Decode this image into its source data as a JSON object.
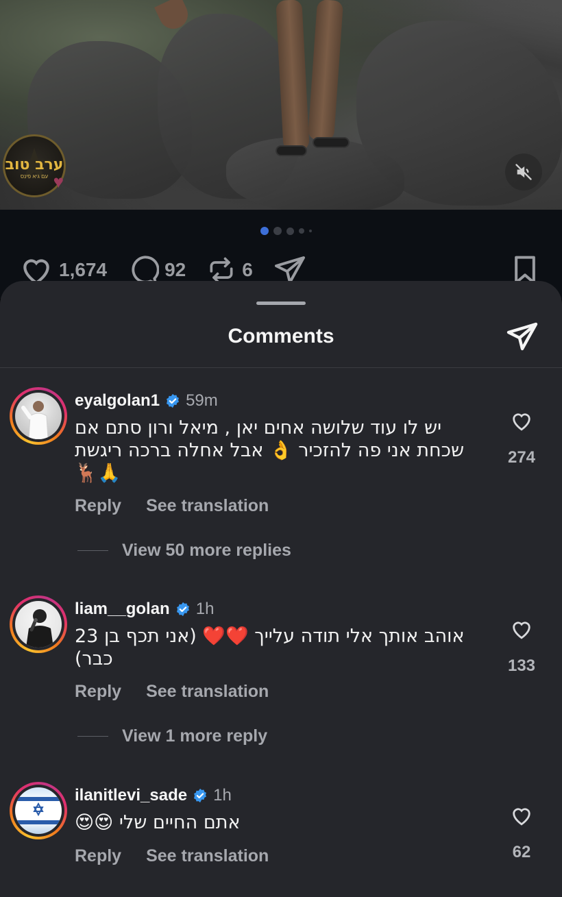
{
  "post": {
    "channel_badge": {
      "title": "ערב טוב",
      "subtitle": "עם גיא פינס"
    },
    "carousel": {
      "count": 5,
      "active_index": 0
    },
    "likes": "1,674",
    "comments": "92",
    "reposts": "6"
  },
  "sheet": {
    "title": "Comments"
  },
  "comments": [
    {
      "username": "eyalgolan1",
      "time": "59m",
      "text": "יש לו עוד שלושה אחים יאן , מיאל ורון סתם אם שכחת אני פה להזכיר 👌 אבל אחלה ברכה ריגשת 🙏🦌",
      "reply_label": "Reply",
      "translation_label": "See translation",
      "likes": "274",
      "view_replies": "View 50 more replies"
    },
    {
      "username": "liam__golan",
      "time": "1h",
      "text": "אוהב אותך אלי תודה עלייך ❤️❤️ (אני תכף בן 23 כבר)",
      "reply_label": "Reply",
      "translation_label": "See translation",
      "likes": "133",
      "view_replies": "View 1 more reply"
    },
    {
      "username": "ilanitlevi_sade",
      "time": "1h",
      "text": "אתם החיים שלי 😍😍",
      "reply_label": "Reply",
      "translation_label": "See translation",
      "likes": "62"
    }
  ],
  "colors": {
    "verified": "#3897f0",
    "sheet_bg": "#25262b",
    "carousel_active": "#3d6fd8"
  }
}
